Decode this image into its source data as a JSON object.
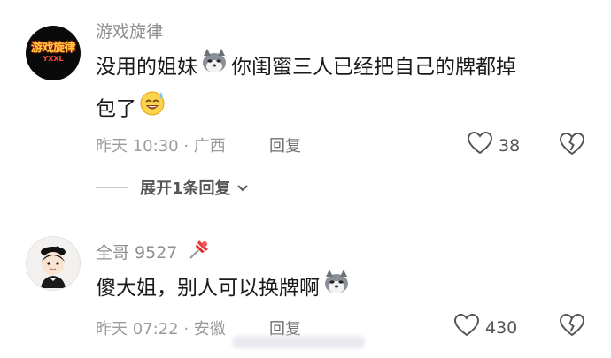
{
  "comments": [
    {
      "avatar": {
        "main": "游戏旋律",
        "sub": "YXXL"
      },
      "username": "游戏旋律",
      "text_line1_a": "没用的姐妹",
      "text_line1_b": "你闺蜜三人已经把自己的牌都掉",
      "text_line2": "包了",
      "meta": "昨天 10:30 · 广西",
      "reply_label": "回复",
      "likes": "38",
      "expand_label": "展开1条回复"
    },
    {
      "username": "全哥 9527",
      "text_a": "傻大姐，别人可以换牌啊",
      "meta": "昨天 07:22 · 安徽",
      "reply_label": "回复",
      "likes": "430"
    }
  ]
}
